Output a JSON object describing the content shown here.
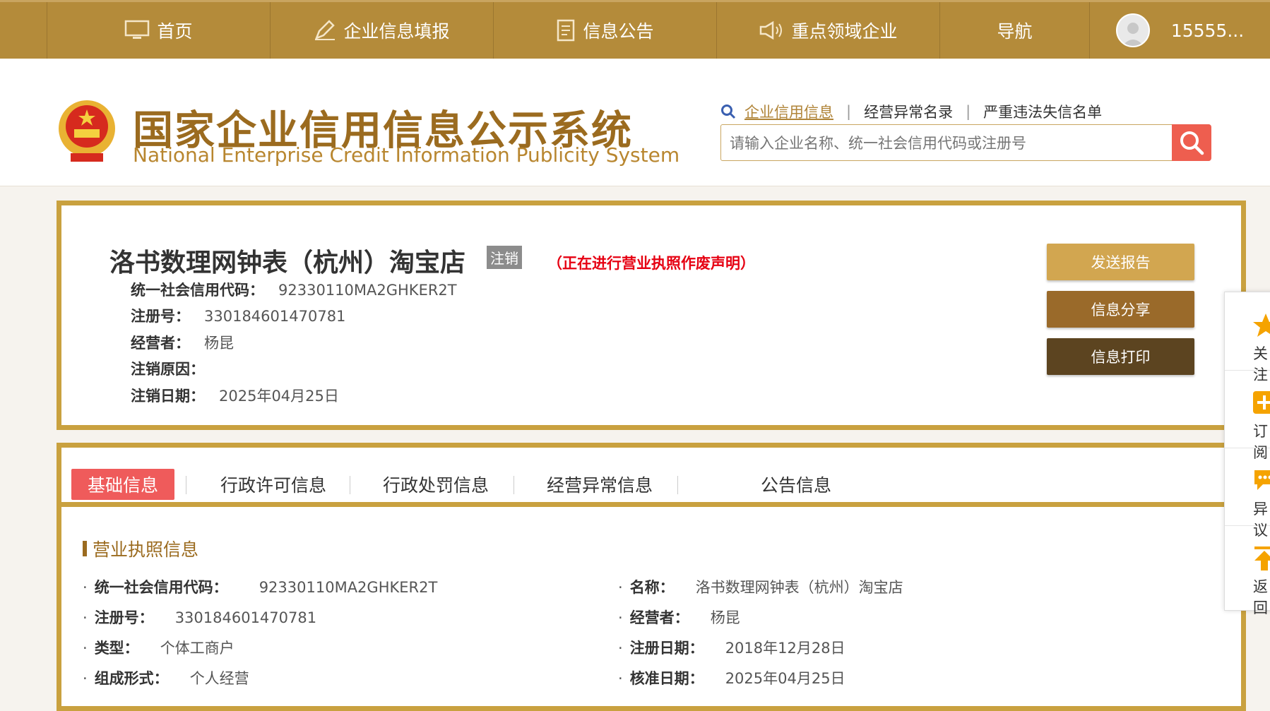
{
  "nav": {
    "items": [
      {
        "label": "首页",
        "icon": "monitor-icon"
      },
      {
        "label": "企业信息填报",
        "icon": "edit-icon"
      },
      {
        "label": "信息公告",
        "icon": "document-icon"
      },
      {
        "label": "重点领域企业",
        "icon": "speaker-icon"
      },
      {
        "label": "导航",
        "icon": ""
      }
    ],
    "user": "15555..."
  },
  "header": {
    "title_cn": "国家企业信用信息公示系统",
    "title_en": "National Enterprise Credit Information Publicity System",
    "search_links": [
      "企业信用信息",
      "经营异常名录",
      "严重违法失信名单"
    ],
    "search_placeholder": "请输入企业名称、统一社会信用代码或注册号"
  },
  "company": {
    "name": "洛书数理网钟表（杭州）淘宝店",
    "status": "注销",
    "note": "（正在进行营业执照作废声明）",
    "fields": [
      {
        "k": "统一社会信用代码：",
        "v": "92330110MA2GHKER2T"
      },
      {
        "k": "注册号：",
        "v": "330184601470781"
      },
      {
        "k": "经营者：",
        "v": "杨昆"
      },
      {
        "k": "注销原因：",
        "v": ""
      },
      {
        "k": "注销日期：",
        "v": "2025年04月25日"
      }
    ]
  },
  "actions": {
    "send_report": "发送报告",
    "share": "信息分享",
    "print": "信息打印"
  },
  "side": [
    "关注",
    "订阅",
    "异议",
    "返回"
  ],
  "tabs": [
    "基础信息",
    "行政许可信息",
    "行政处罚信息",
    "经营异常信息",
    "公告信息"
  ],
  "license": {
    "section_title": "营业执照信息",
    "left": [
      {
        "k": "统一社会信用代码：",
        "v": "92330110MA2GHKER2T"
      },
      {
        "k": "注册号：",
        "v": "330184601470781"
      },
      {
        "k": "类型：",
        "v": "个体工商户"
      },
      {
        "k": "组成形式：",
        "v": "个人经营"
      }
    ],
    "right": [
      {
        "k": "名称：",
        "v": "洛书数理网钟表（杭州）淘宝店"
      },
      {
        "k": "经营者：",
        "v": "杨昆"
      },
      {
        "k": "注册日期：",
        "v": "2018年12月28日"
      },
      {
        "k": "核准日期：",
        "v": "2025年04月25日"
      }
    ]
  },
  "colors": {
    "nav_bg": "#b48b3a",
    "gold_border": "#c9a13f",
    "active_tab": "#ef5b5b",
    "btn_send": "#d2a650",
    "btn_share": "#9a6a2a",
    "btn_print": "#5c4420",
    "status_note": "#e60012"
  }
}
